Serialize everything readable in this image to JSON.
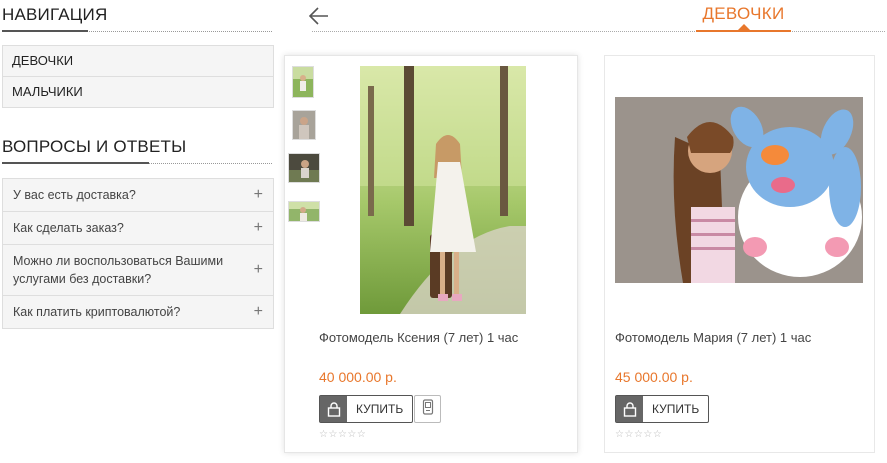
{
  "sidebar": {
    "nav_title": "Навигация",
    "nav_items": [
      {
        "label": "Девочки"
      },
      {
        "label": "Мальчики"
      }
    ],
    "faq_title": "Вопросы и ответы",
    "faq_items": [
      {
        "question": "У вас есть доставка?"
      },
      {
        "question": "Как сделать заказ?"
      },
      {
        "question": "Можно ли воспользоваться Вашими услугами без доставки?"
      },
      {
        "question": "Как платить криптовалютой?"
      }
    ]
  },
  "category": {
    "title": "Девочки"
  },
  "products": [
    {
      "name": "Фотомодель Ксения (7 лет) 1 час",
      "price": "40 000.00 р.",
      "buy_label": "Купить",
      "rating": 0
    },
    {
      "name": "Фотомодель Мария (7 лет) 1 час",
      "price": "45 000.00 р.",
      "buy_label": "Купить",
      "rating": 0
    }
  ],
  "icons": {
    "back": "arrow-left-icon",
    "expand": "plus-icon",
    "cart": "shopping-bag-icon",
    "compare": "compare-icon",
    "rating": "star-icon"
  },
  "colors": {
    "accent": "#e8772c",
    "button_dark": "#666666"
  }
}
